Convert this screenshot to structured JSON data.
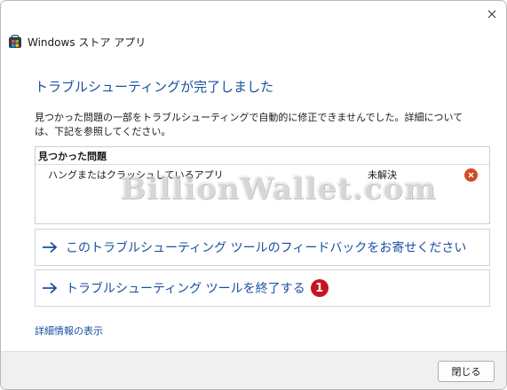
{
  "window": {
    "title": "Windows ストア アプリ",
    "icon": "store-app-icon",
    "close_icon": "close-icon"
  },
  "main": {
    "title": "トラブルシューティングが完了しました",
    "description": "見つかった問題の一部をトラブルシューティングで自動的に修正できませんでした。詳細については、下記を参照してください。"
  },
  "problems": {
    "heading": "見つかった問題",
    "items": [
      {
        "name": "ハングまたはクラッシュしているアプリ",
        "status": "未解決",
        "status_icon": "error-icon"
      }
    ]
  },
  "watermark": "BillionWallet.com",
  "actions": [
    {
      "label": "このトラブルシューティング ツールのフィードバックをお寄せください",
      "icon": "arrow-right-icon"
    },
    {
      "label": "トラブルシューティング ツールを終了する",
      "icon": "arrow-right-icon",
      "badge": "1"
    }
  ],
  "details_link": "詳細情報の表示",
  "footer": {
    "close_label": "閉じる"
  },
  "colors": {
    "accent": "#1a4fa0",
    "error": "#d14b25",
    "badge": "#c8141e"
  }
}
